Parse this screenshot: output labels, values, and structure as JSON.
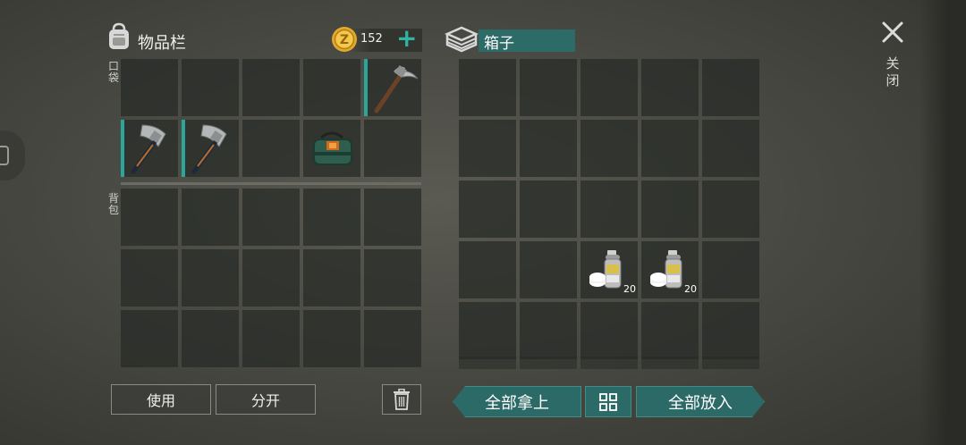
{
  "inventory": {
    "title": "物品栏",
    "coins": "152",
    "add_coins": "+",
    "pocket_label": "口袋",
    "backpack_label": "背包",
    "pocket_slots": [
      {
        "item": "",
        "selected": false
      },
      {
        "item": "",
        "selected": false
      },
      {
        "item": "",
        "selected": false
      },
      {
        "item": "",
        "selected": false
      },
      {
        "item": "pickaxe",
        "selected": true
      },
      {
        "item": "hatchet",
        "selected": true
      },
      {
        "item": "hatchet",
        "selected": true
      },
      {
        "item": "",
        "selected": false
      },
      {
        "item": "supply-bag",
        "selected": false
      },
      {
        "item": "",
        "selected": false
      }
    ],
    "backpack_slot_count": 15,
    "buttons": {
      "use": "使用",
      "split": "分开"
    }
  },
  "box": {
    "name": "箱子",
    "slots": [
      {
        "item": ""
      },
      {
        "item": ""
      },
      {
        "item": ""
      },
      {
        "item": ""
      },
      {
        "item": ""
      },
      {
        "item": ""
      },
      {
        "item": ""
      },
      {
        "item": ""
      },
      {
        "item": ""
      },
      {
        "item": ""
      },
      {
        "item": ""
      },
      {
        "item": ""
      },
      {
        "item": ""
      },
      {
        "item": ""
      },
      {
        "item": ""
      },
      {
        "item": ""
      },
      {
        "item": ""
      },
      {
        "item": "spray-can",
        "qty": "20"
      },
      {
        "item": "spray-can",
        "qty": "20"
      },
      {
        "item": ""
      },
      {
        "item": ""
      },
      {
        "item": ""
      },
      {
        "item": ""
      },
      {
        "item": ""
      },
      {
        "item": ""
      }
    ],
    "buttons": {
      "take_all": "全部拿上",
      "put_all": "全部放入"
    }
  },
  "close": {
    "label": "关闭"
  },
  "colors": {
    "accent": "#2aa79a",
    "button_teal": "#2b6a66",
    "slot": "#262a26"
  }
}
